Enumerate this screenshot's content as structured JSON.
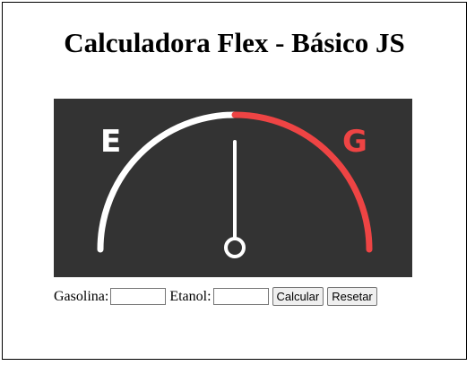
{
  "page": {
    "title": "Calculadora Flex - Básico JS"
  },
  "gauge": {
    "left_label": "E",
    "right_label": "G",
    "colors": {
      "background": "#333333",
      "left_arc": "#ffffff",
      "right_arc": "#ee4444",
      "needle": "#ffffff"
    }
  },
  "form": {
    "gasolina_label": "Gasolina:",
    "gasolina_value": "",
    "etanol_label": "Etanol:",
    "etanol_value": "",
    "calcular_label": "Calcular",
    "resetar_label": "Resetar"
  }
}
